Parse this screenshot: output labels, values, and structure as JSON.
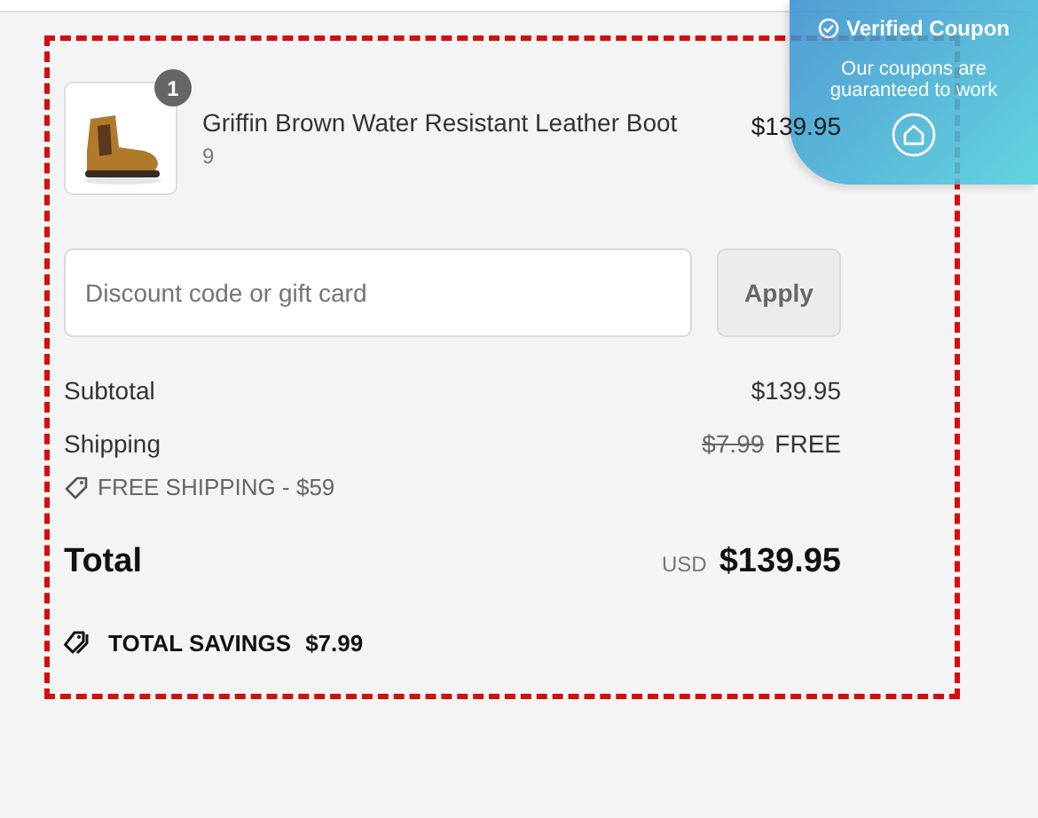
{
  "coupon_popup": {
    "title": "Verified Coupon",
    "message": "Our coupons are guaranteed to work"
  },
  "line_item": {
    "quantity": "1",
    "name": "Griffin Brown Water Resistant Leather Boot",
    "variant": "9",
    "price": "$139.95"
  },
  "discount": {
    "placeholder": "Discount code or gift card",
    "button": "Apply"
  },
  "subtotal": {
    "label": "Subtotal",
    "value": "$139.95"
  },
  "shipping": {
    "label": "Shipping",
    "original": "$7.99",
    "value": "FREE",
    "promo": "FREE SHIPPING - $59"
  },
  "total": {
    "label": "Total",
    "currency": "USD",
    "value": "$139.95"
  },
  "savings": {
    "label": "TOTAL SAVINGS",
    "value": "$7.99"
  }
}
